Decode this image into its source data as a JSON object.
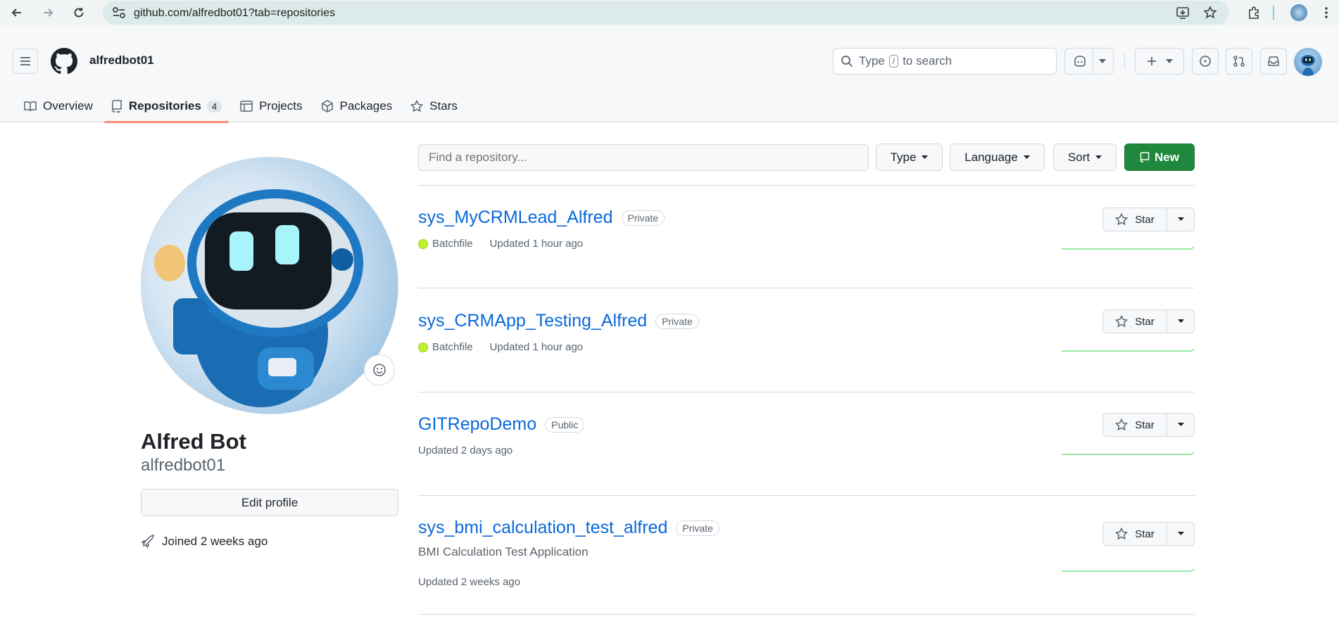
{
  "browser": {
    "url": "github.com/alfredbot01?tab=repositories"
  },
  "header": {
    "username": "alfredbot01",
    "search_pre": "Type",
    "search_key": "/",
    "search_post": "to search"
  },
  "tabs": [
    {
      "label": "Overview",
      "icon": "book-icon"
    },
    {
      "label": "Repositories",
      "icon": "repo-icon",
      "count": "4",
      "active": true
    },
    {
      "label": "Projects",
      "icon": "table-icon"
    },
    {
      "label": "Packages",
      "icon": "package-icon"
    },
    {
      "label": "Stars",
      "icon": "star-icon"
    }
  ],
  "profile": {
    "full_name": "Alfred Bot",
    "login": "alfredbot01",
    "edit_label": "Edit profile",
    "joined": "Joined 2 weeks ago"
  },
  "filters": {
    "find_placeholder": "Find a repository...",
    "type_label": "Type",
    "language_label": "Language",
    "sort_label": "Sort",
    "new_label": "New"
  },
  "repos": [
    {
      "name": "sys_MyCRMLead_Alfred",
      "visibility": "Private",
      "language": "Batchfile",
      "updated": "Updated 1 hour ago",
      "star_label": "Star"
    },
    {
      "name": "sys_CRMApp_Testing_Alfred",
      "visibility": "Private",
      "language": "Batchfile",
      "updated": "Updated 1 hour ago",
      "star_label": "Star"
    },
    {
      "name": "GITRepoDemo",
      "visibility": "Public",
      "updated": "Updated 2 days ago",
      "star_label": "Star"
    },
    {
      "name": "sys_bmi_calculation_test_alfred",
      "visibility": "Private",
      "description": "BMI Calculation Test Application",
      "updated": "Updated 2 weeks ago",
      "star_label": "Star"
    }
  ],
  "colors": {
    "accent_green": "#1f883d",
    "link_blue": "#0969da",
    "tab_underline": "#fd8c73",
    "batchfile": "#c1f12e"
  }
}
